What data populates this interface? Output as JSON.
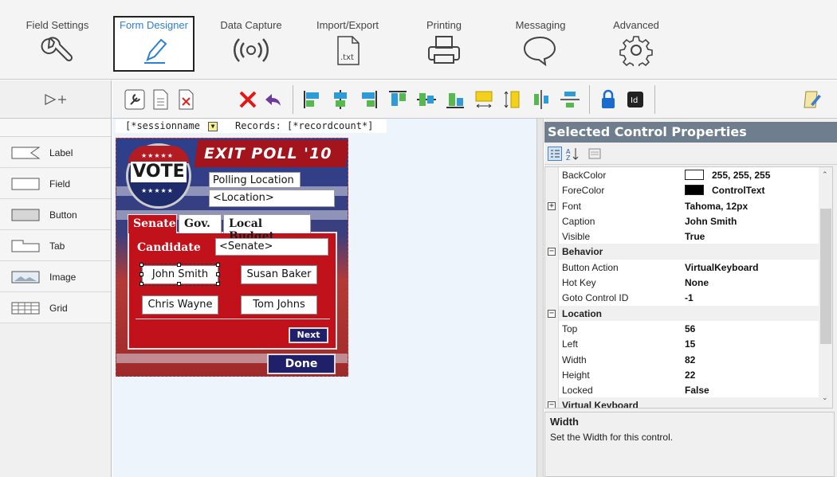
{
  "ribbon": {
    "tabs": [
      {
        "label": "Field Settings",
        "icon": "wrench-icon"
      },
      {
        "label": "Form Designer",
        "icon": "pencil-icon"
      },
      {
        "label": "Data Capture",
        "icon": "radio-waves-icon"
      },
      {
        "label": "Import/Export",
        "icon": "txt-file-icon"
      },
      {
        "label": "Printing",
        "icon": "printer-icon"
      },
      {
        "label": "Messaging",
        "icon": "speech-bubble-icon"
      },
      {
        "label": "Advanced",
        "icon": "gear-icon"
      }
    ],
    "active_tab": "Form Designer",
    "active_color": "#2b7fd5"
  },
  "palette": {
    "items": [
      {
        "label": "Label",
        "icon": "label-icon"
      },
      {
        "label": "Field",
        "icon": "field-icon"
      },
      {
        "label": "Button",
        "icon": "button-icon"
      },
      {
        "label": "Tab",
        "icon": "tab-icon"
      },
      {
        "label": "Image",
        "icon": "image-icon"
      },
      {
        "label": "Grid",
        "icon": "grid-icon"
      }
    ]
  },
  "canvas": {
    "session_text": "[*sessionname",
    "records_text": "Records: [*recordcount*]"
  },
  "form": {
    "title": "EXIT POLL '10",
    "vote_badge": "VOTE",
    "polling_label": "Polling Location",
    "location_value": "<Location>",
    "tabs": [
      "Senate",
      "Gov.",
      "Local Budget"
    ],
    "candidate_label": "Candidate",
    "candidate_value": "<Senate>",
    "buttons": [
      "John Smith",
      "Susan Baker",
      "Chris Wayne",
      "Tom Johns"
    ],
    "next_label": "Next",
    "done_label": "Done"
  },
  "properties": {
    "title": "Selected Control Properties",
    "rows": [
      {
        "name": "BackColor",
        "value": "255, 255, 255",
        "swatch": "#ffffff"
      },
      {
        "name": "ForeColor",
        "value": "ControlText",
        "swatch": "#000000"
      },
      {
        "name": "Font",
        "value": "Tahoma, 12px",
        "expand": "+"
      },
      {
        "name": "Caption",
        "value": "John Smith"
      },
      {
        "name": "Visible",
        "value": "True"
      },
      {
        "name": "Behavior",
        "category": true,
        "expand": "-"
      },
      {
        "name": "Button Action",
        "value": "VirtualKeyboard"
      },
      {
        "name": "Hot Key",
        "value": "None"
      },
      {
        "name": "Goto Control ID",
        "value": "-1"
      },
      {
        "name": "Location",
        "category": true,
        "expand": "-"
      },
      {
        "name": "Top",
        "value": "56"
      },
      {
        "name": "Left",
        "value": "15"
      },
      {
        "name": "Width",
        "value": "82"
      },
      {
        "name": "Height",
        "value": "22"
      },
      {
        "name": "Locked",
        "value": "False"
      },
      {
        "name": "Virtual Keyboard",
        "category": true,
        "expand": "-"
      }
    ],
    "help_title": "Width",
    "help_text": "Set the Width for this control."
  }
}
